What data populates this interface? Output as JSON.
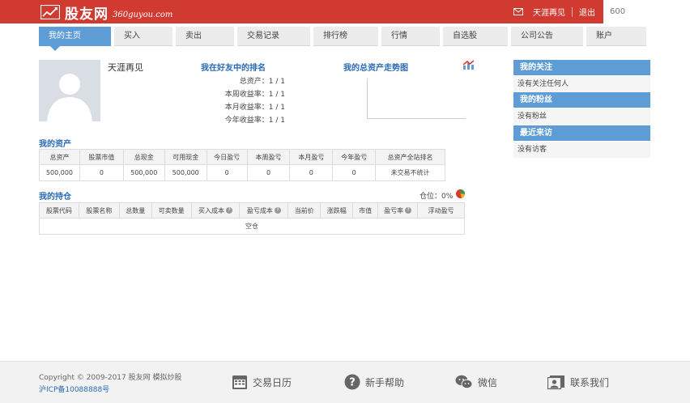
{
  "header": {
    "logo_cn": "股友网",
    "logo_en": "360guyou.com",
    "username": "天涯再见",
    "logout": "退出",
    "search_placeholder": "600",
    "mail_icon": "mail-icon"
  },
  "nav": {
    "tabs": [
      "我的主页",
      "买入",
      "卖出",
      "交易记录",
      "排行榜",
      "行情",
      "自选股",
      "公司公告",
      "账户"
    ],
    "active_index": 0
  },
  "profile": {
    "name": "天涯再见",
    "rank_title": "我在好友中的排名",
    "rank_rows": [
      "总资产：1 / 1",
      "本周收益率：1 / 1",
      "本月收益率：1 / 1",
      "今年收益率：1 / 1"
    ],
    "trend_title": "我的总资产走势图"
  },
  "assets": {
    "title": "我的资产",
    "headers": [
      "总资产",
      "股票市值",
      "总现金",
      "可用现金",
      "今日盈亏",
      "本周盈亏",
      "本月盈亏",
      "今年盈亏",
      "总资产全站排名"
    ],
    "values": [
      "500,000",
      "0",
      "500,000",
      "500,000",
      "0",
      "0",
      "0",
      "0",
      "未交易不统计"
    ]
  },
  "holdings": {
    "title": "我的持仓",
    "position_label": "仓位：0%",
    "headers": [
      "股票代码",
      "股票名称",
      "总数量",
      "可卖数量",
      "买入成本",
      "盈亏成本",
      "当前价",
      "涨跌幅",
      "市值",
      "盈亏率",
      "浮动盈亏"
    ],
    "help_columns": [
      4,
      5,
      9
    ],
    "empty_text": "空仓"
  },
  "sidebar": {
    "following_title": "我的关注",
    "following_empty": "没有关注任何人",
    "fans_title": "我的粉丝",
    "fans_empty": "没有粉丝",
    "visitors_title": "最近来访",
    "visitors_empty": "没有访客"
  },
  "footer": {
    "copyright": "Copyright © 2009-2017 股友网 模拟炒股",
    "icp": "沪ICP备10088888号",
    "links": [
      "交易日历",
      "新手帮助",
      "微信",
      "联系我们"
    ]
  },
  "colors": {
    "header_red": "#d03a31",
    "accent_blue": "#5d9cd4",
    "title_blue": "#2a6bb3"
  }
}
